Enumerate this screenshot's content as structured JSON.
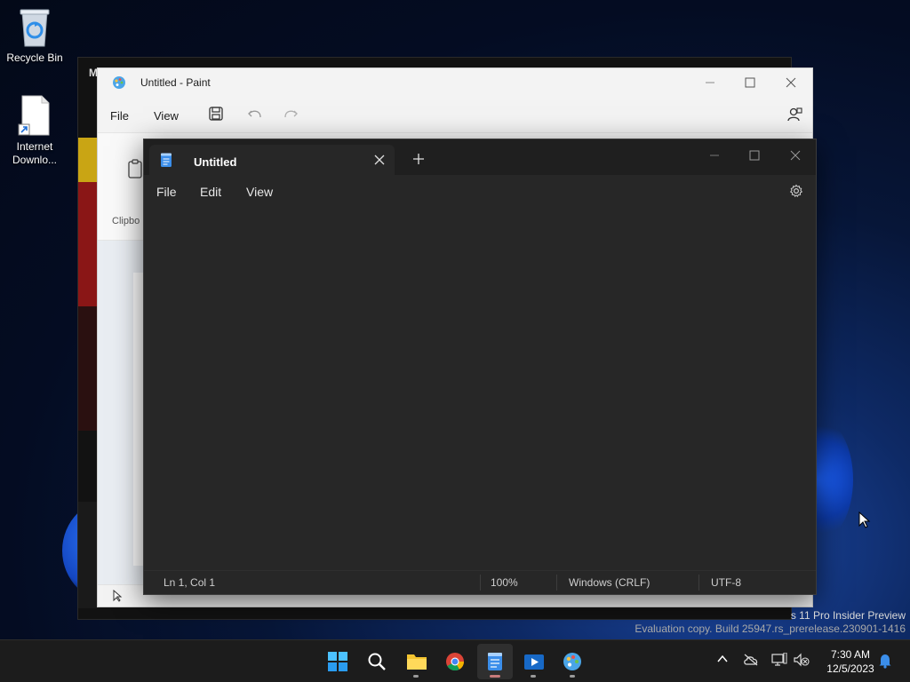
{
  "desktop": {
    "icons": [
      {
        "label": "Recycle Bin"
      },
      {
        "label": "Internet Downlo..."
      }
    ],
    "watermark": {
      "line1": "s 11 Pro Insider Preview",
      "line2": "Evaluation copy. Build 25947.rs_prerelease.230901-1416"
    },
    "behind_window_letter": "M"
  },
  "paint": {
    "title": "Untitled - Paint",
    "menu": [
      "File",
      "View"
    ],
    "clipboard_label": "Clipbo"
  },
  "notepad": {
    "tab_title": "Untitled",
    "menu": [
      "File",
      "Edit",
      "View"
    ],
    "status": {
      "position": "Ln 1, Col 1",
      "zoom": "100%",
      "line_ending": "Windows (CRLF)",
      "encoding": "UTF-8"
    }
  },
  "taskbar": {
    "apps": [
      {
        "name": "Start"
      },
      {
        "name": "Search"
      },
      {
        "name": "File Explorer"
      },
      {
        "name": "Chrome"
      },
      {
        "name": "Notepad"
      },
      {
        "name": "Media Player"
      },
      {
        "name": "Paint"
      }
    ],
    "clock": {
      "time": "7:30 AM",
      "date": "12/5/2023"
    }
  },
  "colors": {
    "notepad_bg": "#272727",
    "taskbar_bg": "#1c1c1c",
    "accent": "#3b8eea"
  }
}
